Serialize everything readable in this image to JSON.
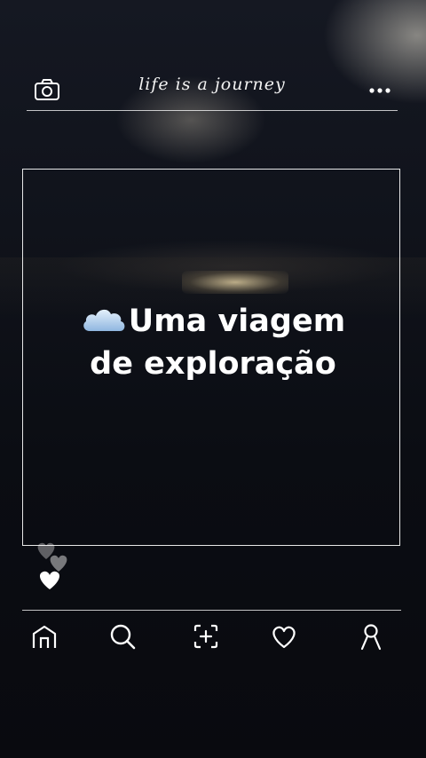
{
  "header": {
    "title": "life is a journey",
    "left_icon": "camera-icon",
    "right_icon": "more-icon"
  },
  "post": {
    "caption_line1": "Uma viagem",
    "caption_line2": "de exploração",
    "caption_icon": "cloud-icon"
  },
  "reactions": {
    "icon": "hearts-icon"
  },
  "nav": {
    "items": [
      {
        "icon": "home-icon"
      },
      {
        "icon": "search-icon"
      },
      {
        "icon": "add-post-icon"
      },
      {
        "icon": "heart-icon"
      },
      {
        "icon": "profile-icon"
      }
    ]
  },
  "colors": {
    "background": "#0c0e14",
    "foreground": "#ffffff",
    "cloud": "#a9c8ea"
  }
}
